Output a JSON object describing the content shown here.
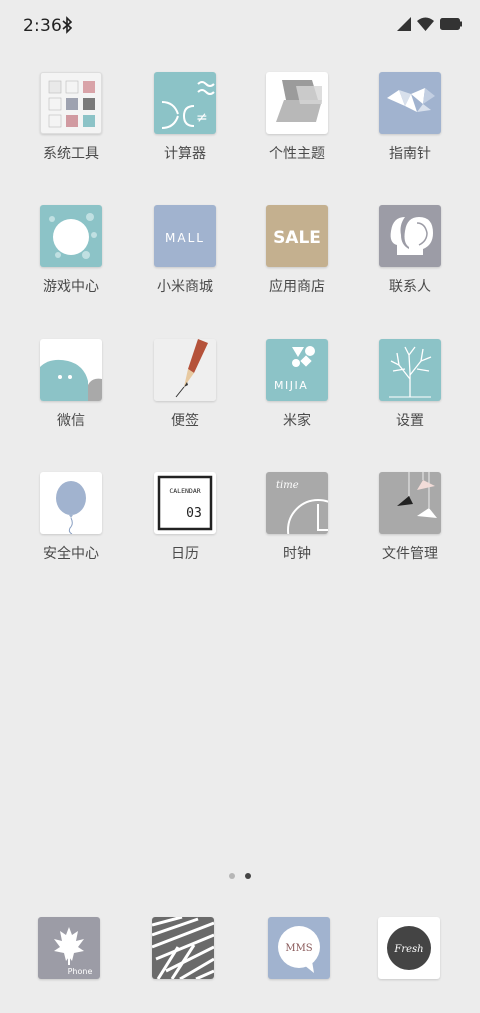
{
  "status": {
    "time": "2:36"
  },
  "apps": [
    {
      "label": "系统工具"
    },
    {
      "label": "计算器"
    },
    {
      "label": "个性主题"
    },
    {
      "label": "指南针"
    },
    {
      "label": "游戏中心"
    },
    {
      "label": "小米商城",
      "tile_text": "MALL"
    },
    {
      "label": "应用商店",
      "tile_text": "SALE"
    },
    {
      "label": "联系人"
    },
    {
      "label": "微信"
    },
    {
      "label": "便签"
    },
    {
      "label": "米家",
      "tile_text": "MIJIA"
    },
    {
      "label": "设置"
    },
    {
      "label": "安全中心"
    },
    {
      "label": "日历",
      "tile_text": "CALENDAR",
      "tile_num": "03"
    },
    {
      "label": "时钟",
      "tile_text": "time"
    },
    {
      "label": "文件管理"
    }
  ],
  "pager": {
    "pages": 2,
    "current": 2
  },
  "dock": [
    {
      "name": "phone",
      "tile_text": "Phone"
    },
    {
      "name": "messages"
    },
    {
      "name": "mms",
      "tile_text": "MMS"
    },
    {
      "name": "browser",
      "tile_text": "Fresh"
    }
  ],
  "colors": {
    "background": "#ececec",
    "teal": "#8cc3c7",
    "blue": "#a1b3cf",
    "gray": "#9c9ca6"
  }
}
